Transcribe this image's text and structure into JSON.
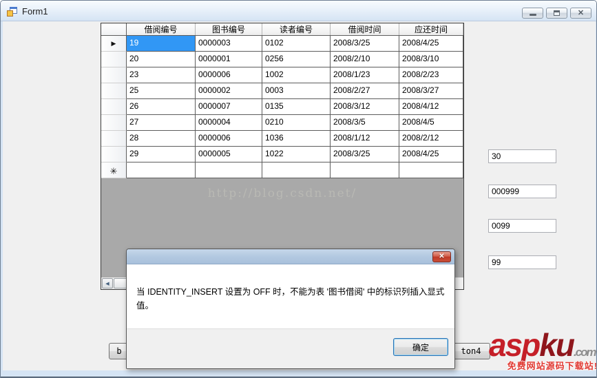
{
  "window": {
    "title": "Form1",
    "caption": {
      "minimize": "minimize",
      "maximize": "maximize",
      "close": "close"
    }
  },
  "grid": {
    "columns": [
      "借阅编号",
      "图书编号",
      "读者编号",
      "借阅时间",
      "应还时间"
    ],
    "rows": [
      [
        "19",
        "0000003",
        "0102",
        "2008/3/25",
        "2008/4/25"
      ],
      [
        "20",
        "0000001",
        "0256",
        "2008/2/10",
        "2008/3/10"
      ],
      [
        "23",
        "0000006",
        "1002",
        "2008/1/23",
        "2008/2/23"
      ],
      [
        "25",
        "0000002",
        "0003",
        "2008/2/27",
        "2008/3/27"
      ],
      [
        "26",
        "0000007",
        "0135",
        "2008/3/12",
        "2008/4/12"
      ],
      [
        "27",
        "0000004",
        "0210",
        "2008/3/5",
        "2008/4/5"
      ],
      [
        "28",
        "0000006",
        "1036",
        "2008/1/12",
        "2008/2/12"
      ],
      [
        "29",
        "0000005",
        "1022",
        "2008/3/25",
        "2008/4/25"
      ]
    ],
    "selected_row_index": 0,
    "current_row_marker": "▶",
    "new_row_marker": "✳",
    "watermark": "http://blog.csdn.net/"
  },
  "textboxes": [
    "30",
    "000999",
    "0099",
    "99"
  ],
  "form_buttons": {
    "left_visible_label": "b",
    "right_visible_label": "ton4"
  },
  "dialog": {
    "message": "当 IDENTITY_INSERT 设置为 OFF 时，不能为表 '图书借阅' 中的标识列插入显式值。",
    "ok_label": "确定",
    "close_glyph": "✕"
  },
  "site_watermark": {
    "asp": "asp",
    "ku": "ku",
    "com": ".com",
    "tagline": "免费网站源码下载站!"
  },
  "colors": {
    "selection_blue": "#3197f5",
    "grid_empty_gray": "#a9a9a9",
    "dialog_close_red": "#bf3a28",
    "aspku_red": "#c51f28"
  }
}
